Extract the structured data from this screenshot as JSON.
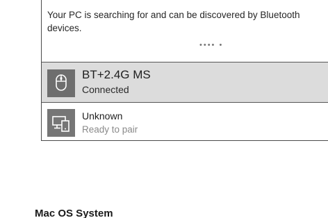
{
  "bluetooth_panel": {
    "status_message": "Your PC is searching for and can be discovered by Bluetooth devices.",
    "searching_indicator": "•••• •",
    "devices": [
      {
        "name": "BT+2.4G MS",
        "state": "Connected",
        "icon": "mouse-icon"
      },
      {
        "name": "Unknown",
        "state": "Ready to pair",
        "icon": "devices-icon"
      }
    ]
  },
  "section_heading": "Mac OS System"
}
